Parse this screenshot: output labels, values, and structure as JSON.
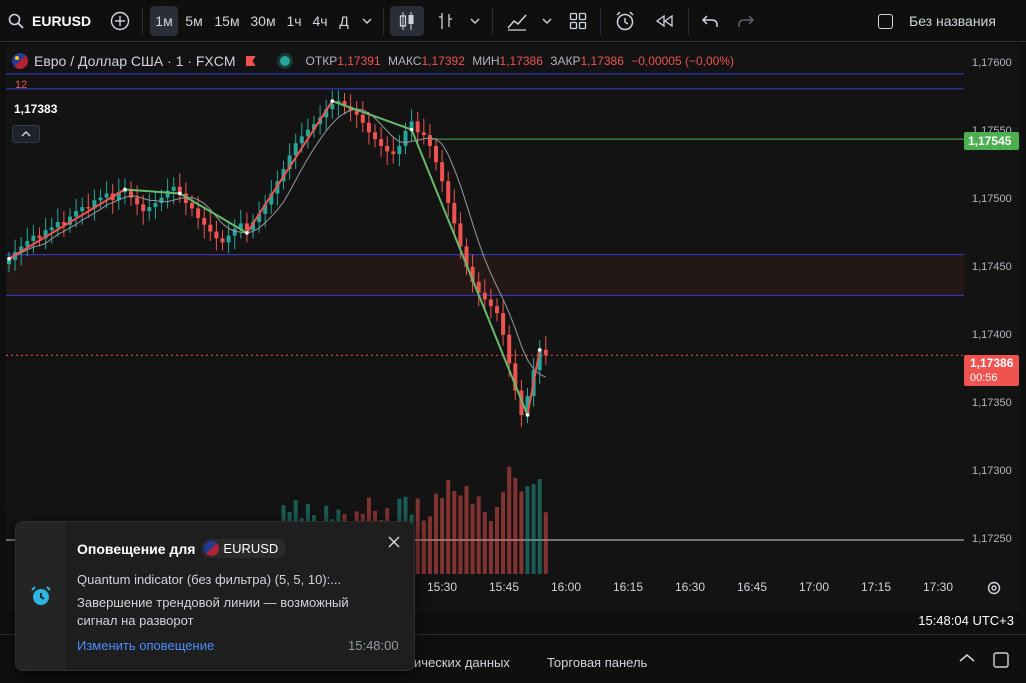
{
  "toolbar": {
    "symbol": "EURUSD",
    "timeframes": [
      "1м",
      "5м",
      "15м",
      "30м",
      "1ч",
      "4ч",
      "Д"
    ],
    "active_timeframe": "1м",
    "layout_name": "Без названия"
  },
  "legend": {
    "title": "Евро / Доллар США · 1 · FXCM",
    "open_label": "ОТКР",
    "open": "1,17391",
    "high_label": "МАКС",
    "high": "1,17392",
    "low_label": "МИН",
    "low": "1,17386",
    "close_label": "ЗАКР",
    "close": "1,17386",
    "change": "−0,00005 (−0,00%)",
    "indicator_value": "12",
    "crosshair_value": "1,17383"
  },
  "price_axis": {
    "ticks": [
      "1,17600",
      "1,17550",
      "1,17500",
      "1,17450",
      "1,17400",
      "1,17350",
      "1,17300",
      "1,17250"
    ],
    "green_label": "1,17545",
    "current_price": "1,17386",
    "countdown": "00:56"
  },
  "time_axis": {
    "ticks": [
      "15:30",
      "15:45",
      "16:00",
      "16:15",
      "16:30",
      "16:45",
      "17:00",
      "17:15",
      "17:30"
    ]
  },
  "status": {
    "clock": "15:48:04 UTC+3"
  },
  "bottom": {
    "tab_hist": "ических данных",
    "tab_trading": "Торговая панель"
  },
  "toast": {
    "title": "Оповещение для",
    "symbol": "EURUSD",
    "line1": "Quantum indicator (без фильтра) (5, 5, 10):...",
    "line2": "Завершение трендовой линии — возможный сигнал на разворот",
    "link": "Изменить оповещение",
    "time": "15:48:00"
  },
  "colors": {
    "up": "#26a69a",
    "down": "#ef5350",
    "accent": "#2962ff",
    "green_line": "#4caf50"
  },
  "chart_data": {
    "type": "candlestick",
    "ylim": [
      1.17225,
      1.17615
    ],
    "closes": [
      1.17456,
      1.17462,
      1.17466,
      1.1747,
      1.17474,
      1.17472,
      1.17478,
      1.1748,
      1.17484,
      1.17482,
      1.17488,
      1.17492,
      1.17495,
      1.17494,
      1.175,
      1.17502,
      1.17505,
      1.175,
      1.17506,
      1.17508,
      1.17502,
      1.17497,
      1.17492,
      1.17495,
      1.17498,
      1.17502,
      1.17507,
      1.1751,
      1.17505,
      1.17498,
      1.17494,
      1.17487,
      1.17482,
      1.17477,
      1.17472,
      1.17469,
      1.17474,
      1.17479,
      1.17483,
      1.17478,
      1.17484,
      1.1749,
      1.17497,
      1.17505,
      1.17514,
      1.17523,
      1.17533,
      1.17542,
      1.17547,
      1.17552,
      1.17556,
      1.17561,
      1.17567,
      1.17571,
      1.17573,
      1.17569,
      1.17566,
      1.17563,
      1.17557,
      1.1755,
      1.17545,
      1.1754,
      1.17536,
      1.17534,
      1.1754,
      1.17551,
      1.17558,
      1.1755,
      1.17548,
      1.1754,
      1.17528,
      1.17514,
      1.17498,
      1.17483,
      1.17466,
      1.17451,
      1.1744,
      1.17432,
      1.17427,
      1.17422,
      1.17417,
      1.17401,
      1.1738,
      1.1736,
      1.17342,
      1.17356,
      1.17375,
      1.1739,
      1.17386
    ]
  }
}
